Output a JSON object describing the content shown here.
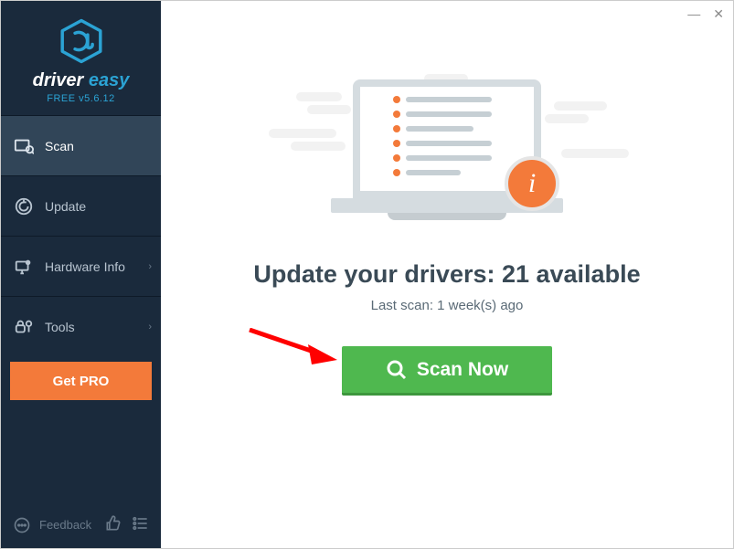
{
  "brand": {
    "name1": "driver",
    "name2": " easy",
    "version": "FREE v5.6.12"
  },
  "nav": {
    "scan": "Scan",
    "update": "Update",
    "hardware": "Hardware Info",
    "tools": "Tools"
  },
  "get_pro": "Get PRO",
  "bottom": {
    "feedback": "Feedback"
  },
  "win": {
    "min": "—",
    "close": "✕"
  },
  "main": {
    "headline": "Update your drivers: 21 available",
    "subline": "Last scan: 1 week(s) ago",
    "scan_btn": "Scan Now",
    "info_badge": "i"
  }
}
